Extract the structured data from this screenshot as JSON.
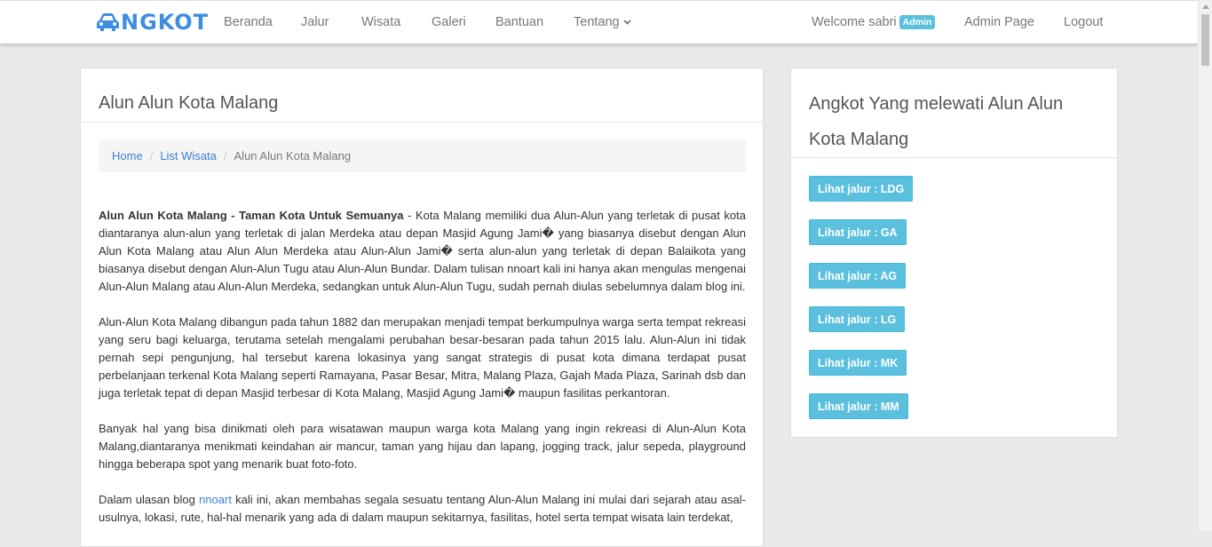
{
  "navbar": {
    "brand": "NGKOT",
    "links": [
      "Beranda",
      "Jalur",
      "Wisata",
      "Galeri",
      "Bantuan",
      "Tentang"
    ],
    "welcome": "Welcome sabri",
    "badge": "Admin",
    "admin_page": "Admin Page",
    "logout": "Logout"
  },
  "main": {
    "title": "Alun Alun Kota Malang",
    "breadcrumb": [
      "Home",
      "List Wisata",
      "Alun Alun Kota Malang"
    ],
    "p1_bold": "Alun Alun Kota Malang - Taman Kota Untuk Semuanya",
    "p1_text": " - Kota Malang memiliki dua Alun-Alun yang terletak di pusat kota diantaranya alun-alun yang terletak di jalan Merdeka atau depan Masjid Agung Jami� yang biasanya disebut dengan Alun Alun Kota Malang atau Alun Alun Merdeka atau Alun-Alun Jami� serta alun-alun yang terletak di depan Balaikota yang biasanya disebut dengan Alun-Alun Tugu atau Alun-Alun Bundar. Dalam tulisan nnoart kali ini hanya akan mengulas mengenai Alun-Alun Malang atau Alun-Alun Merdeka, sedangkan untuk Alun-Alun Tugu, sudah pernah diulas sebelumnya dalam blog ini.",
    "p2": "Alun-Alun Kota Malang dibangun pada tahun 1882  dan merupakan menjadi tempat berkumpulnya warga serta tempat rekreasi yang seru bagi keluarga, terutama setelah mengalami perubahan besar-besaran pada tahun 2015 lalu. Alun-Alun ini tidak pernah sepi pengunjung, hal tersebut karena lokasinya yang sangat strategis di pusat kota dimana terdapat pusat perbelanjaan terkenal Kota Malang seperti Ramayana, Pasar Besar, Mitra, Malang Plaza, Gajah Mada Plaza, Sarinah dsb dan juga terletak tepat di depan Masjid terbesar di Kota Malang, Masjid Agung Jami� maupun fasilitas perkantoran.",
    "p3": "Banyak hal yang bisa dinikmati oleh para wisatawan maupun warga kota Malang yang ingin rekreasi di Alun-Alun Kota Malang,diantaranya menikmati keindahan air mancur, taman yang hijau dan lapang, jogging track, jalur sepeda, playground hingga beberapa spot yang menarik buat foto-foto.",
    "p4_pre": "Dalam ulasan blog ",
    "p4_link": "nnoart",
    "p4_post": " kali ini, akan membahas segala sesuatu tentang Alun-Alun Malang ini mulai dari sejarah atau asal-usulnya, lokasi, rute, hal-hal menarik yang ada di dalam maupun sekitarnya, fasilitas, hotel serta tempat wisata lain terdekat,"
  },
  "sidebar": {
    "title": "Angkot Yang melewati Alun Alun Kota Malang",
    "buttons": [
      "Lihat jalur : LDG",
      "Lihat jalur : GA",
      "Lihat jalur : AG",
      "Lihat jalur : LG",
      "Lihat jalur : MK",
      "Lihat jalur : MM"
    ]
  },
  "colors": {
    "brand": "#3d8ee0",
    "badge": "#5bc0de",
    "link": "#3c7fd0",
    "button": "#5bc0de"
  }
}
